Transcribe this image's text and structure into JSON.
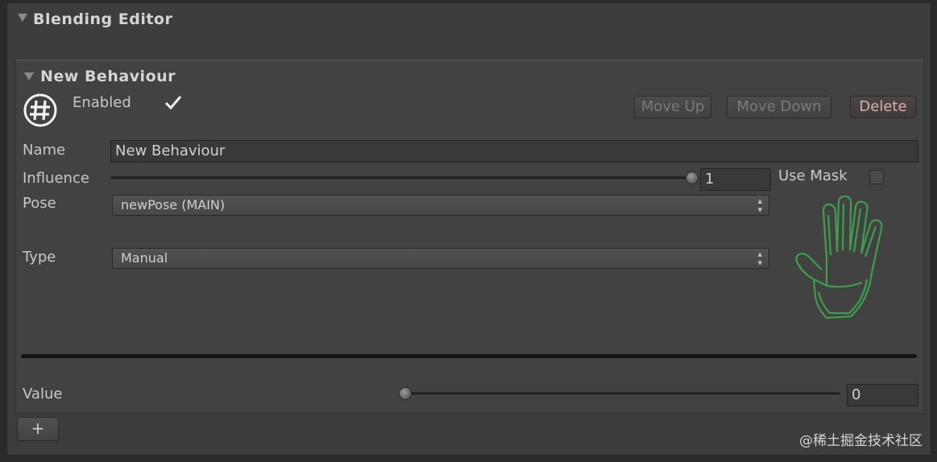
{
  "header": {
    "title": "Blending Editor"
  },
  "behaviour": {
    "title": "New Behaviour",
    "enabled_label": "Enabled",
    "enabled": true,
    "buttons": {
      "move_up": "Move Up",
      "move_down": "Move Down",
      "delete": "Delete"
    },
    "name_label": "Name",
    "name_value": "New Behaviour",
    "influence_label": "Influence",
    "influence_value": "1",
    "influence_fraction": 1.0,
    "use_mask_label": "Use Mask",
    "use_mask": false,
    "pose_label": "Pose",
    "pose_value": "newPose (MAIN)",
    "type_label": "Type",
    "type_value": "Manual",
    "value_label": "Value",
    "value_value": "0",
    "value_fraction": 0.0,
    "icons": [
      "hash-icon",
      "hand-icon",
      "checkmark-icon",
      "dropdown-arrows-icon",
      "fold-arrow-icon"
    ]
  },
  "footer": {
    "add_label": "+"
  },
  "watermark": "@稀土掘金技术社区",
  "colors": {
    "background": "#3d3d3d",
    "hand": "#3fae4f",
    "delete_text": "#d8b0a8"
  }
}
